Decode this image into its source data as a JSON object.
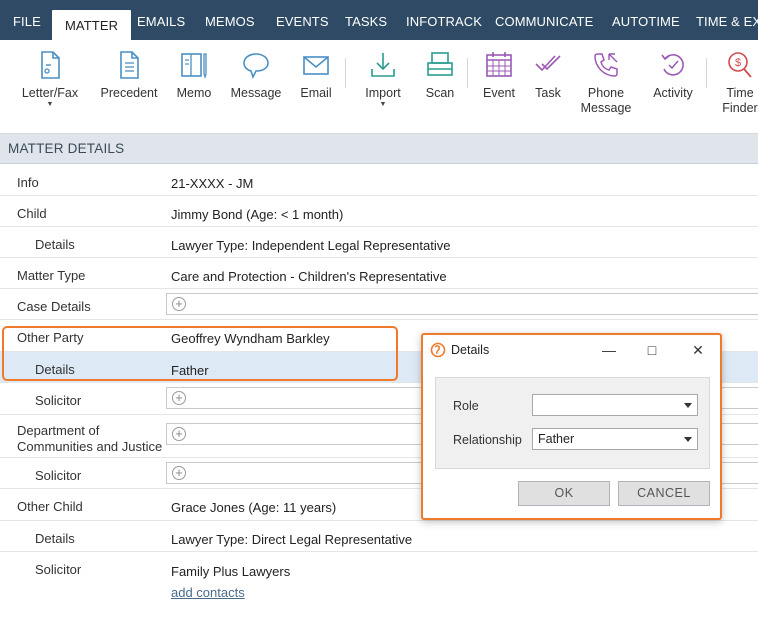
{
  "tabs": [
    {
      "label": "FILE"
    },
    {
      "label": "MATTER",
      "active": true
    },
    {
      "label": "EMAILS"
    },
    {
      "label": "MEMOS"
    },
    {
      "label": "EVENTS"
    },
    {
      "label": "TASKS"
    },
    {
      "label": "INFOTRACK"
    },
    {
      "label": "COMMUNICATE"
    },
    {
      "label": "AUTOTIME"
    },
    {
      "label": "TIME & EXP"
    }
  ],
  "ribbon": {
    "letter_fax": "Letter/Fax",
    "precedent": "Precedent",
    "memo": "Memo",
    "message": "Message",
    "email": "Email",
    "import": "Import",
    "scan": "Scan",
    "event": "Event",
    "task": "Task",
    "phone_line1": "Phone",
    "phone_line2": "Message",
    "activity": "Activity",
    "time_line1": "Time",
    "time_line2": "Finder"
  },
  "section": {
    "title": "MATTER DETAILS"
  },
  "rows": {
    "info_label": "Info",
    "info_value": "21-XXXX - JM",
    "child_label": "Child",
    "child_value": "Jimmy Bond (Age: < 1 month)",
    "child_details_label": "Details",
    "child_details_value": "Lawyer Type: Independent Legal Representative",
    "matter_type_label": "Matter Type",
    "matter_type_value": "Care and Protection - Children's Representative",
    "case_details_label": "Case Details",
    "other_party_label": "Other Party",
    "other_party_value": "Geoffrey Wyndham Barkley",
    "other_party_details_label": "Details",
    "other_party_details_value": "Father",
    "solicitor1_label": "Solicitor",
    "dcj_label_line1": "Department of",
    "dcj_label_line2": "Communities and Justice",
    "solicitor2_label": "Solicitor",
    "other_child_label": "Other Child",
    "other_child_value": "Grace Jones (Age: 11 years)",
    "other_child_details_label": "Details",
    "other_child_details_value": "Lawyer Type: Direct Legal Representative",
    "solicitor3_label": "Solicitor",
    "solicitor3_value": "Family Plus Lawyers",
    "add_contacts": "add contacts",
    "plus_glyph": "+"
  },
  "dialog": {
    "title": "Details",
    "minimize": "—",
    "maximize": "□",
    "close": "✕",
    "role_label": "Role",
    "role_value": "",
    "relationship_label": "Relationship",
    "relationship_value": "Father",
    "ok": "OK",
    "cancel": "CANCEL"
  },
  "colors": {
    "tabbar": "#2e4a64",
    "accent_icon": "#4a8fc4",
    "scan_icon": "#2a9d8f",
    "purple_icon": "#9b59b6",
    "callout": "#f07a2c",
    "highlight_row": "#dde9f4"
  }
}
